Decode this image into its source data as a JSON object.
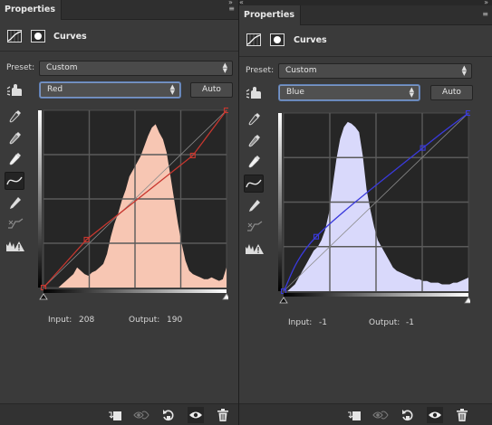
{
  "left_panel": {
    "tab_label": "Properties",
    "adjustment_title": "Curves",
    "preset_label": "Preset:",
    "preset_value": "Custom",
    "channel_value": "Red",
    "auto_label": "Auto",
    "input_label": "Input:",
    "input_value": "208",
    "output_label": "Output:",
    "output_value": "190",
    "curve_color": "#c8372f",
    "histogram_color": "#f7c6b3"
  },
  "right_panel": {
    "tab_label": "Properties",
    "adjustment_title": "Curves",
    "preset_label": "Preset:",
    "preset_value": "Custom",
    "channel_value": "Blue",
    "auto_label": "Auto",
    "input_label": "Input:",
    "input_value": "-1",
    "output_label": "Output:",
    "output_value": "-1",
    "curve_color": "#3a3adc",
    "histogram_color": "#d9d9fb"
  },
  "tools": [
    "on-image-adjust-icon",
    "black-point-eyedropper-icon",
    "gray-point-eyedropper-icon",
    "white-point-eyedropper-icon",
    "curve-points-icon",
    "pencil-draw-icon",
    "smooth-curve-icon",
    "clipping-warning-icon"
  ],
  "footer_icons": [
    "clip-to-layer-icon",
    "view-previous-icon",
    "reset-icon",
    "visibility-eye-icon",
    "trash-icon"
  ]
}
